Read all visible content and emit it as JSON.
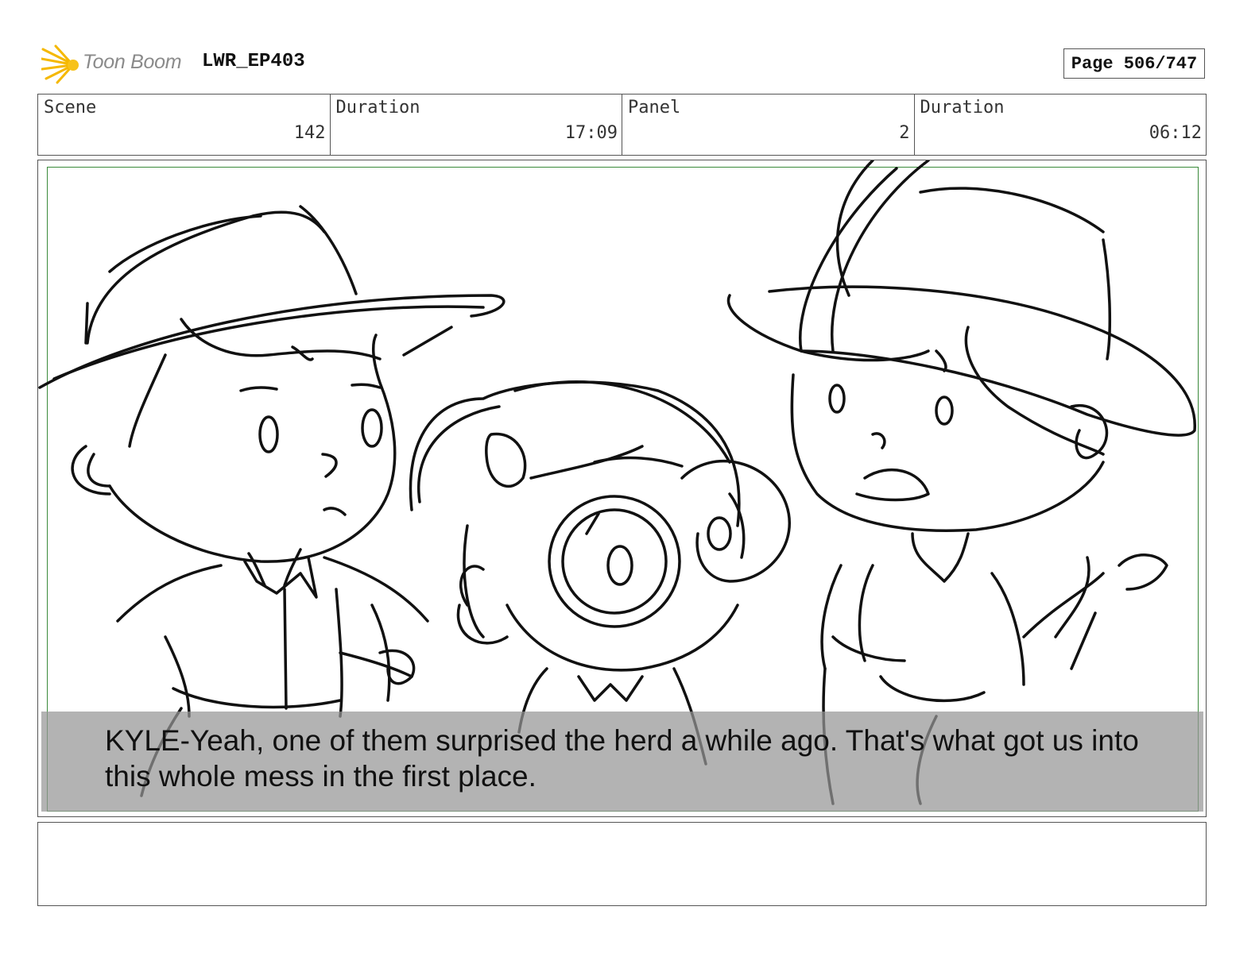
{
  "header": {
    "logo_text": "Toon Boom",
    "project": "LWR_EP403",
    "page": "Page 506/747"
  },
  "info": {
    "scene_label": "Scene",
    "scene_value": "142",
    "scene_duration_label": "Duration",
    "scene_duration_value": "17:09",
    "panel_label": "Panel",
    "panel_value": "2",
    "panel_duration_label": "Duration",
    "panel_duration_value": "06:12"
  },
  "panel": {
    "caption": "KYLE-Yeah, one of them surprised the herd a while ago. That's what got us into this whole mess in the first place."
  },
  "notes": {
    "text": ""
  }
}
